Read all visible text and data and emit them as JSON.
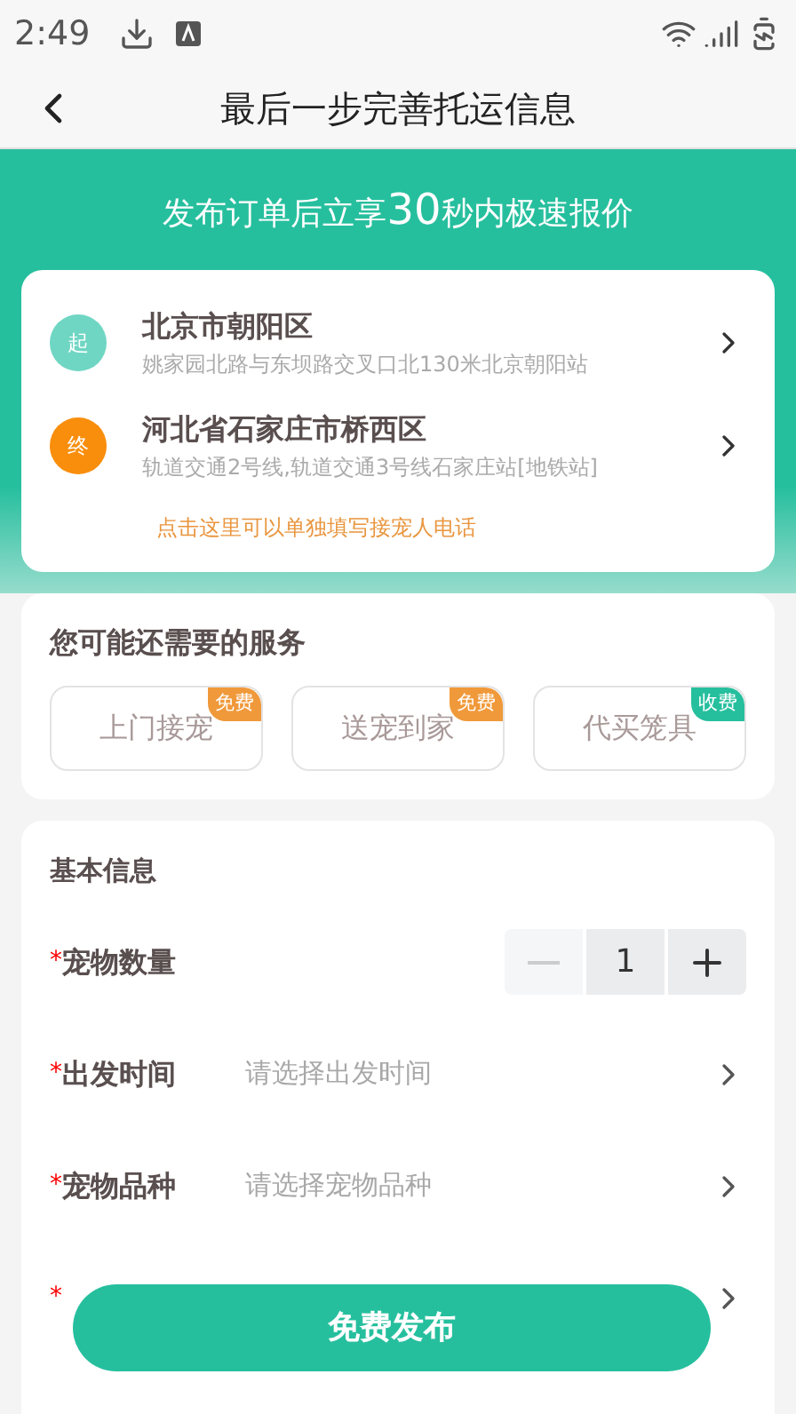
{
  "status_bar": {
    "time": "2:49"
  },
  "header": {
    "title": "最后一步完善托运信息"
  },
  "banner": {
    "before": "发布订单后立享",
    "highlight": "30",
    "after": "秒内极速报价"
  },
  "route": {
    "stops": [
      {
        "kind": "start",
        "badge": "起",
        "city": "北京市朝阳区",
        "address": "姚家园北路与东坝路交叉口北130米北京朝阳站"
      },
      {
        "kind": "end",
        "badge": "终",
        "city": "河北省石家庄市桥西区",
        "address": "轨道交通2号线,轨道交通3号线石家庄站[地铁站]"
      }
    ],
    "phone_link": "点击这里可以单独填写接宠人电话"
  },
  "services": {
    "title": "您可能还需要的服务",
    "items": [
      {
        "label": "上门接宠",
        "tag": "免费",
        "color": "#f0993a"
      },
      {
        "label": "送宠到家",
        "tag": "免费",
        "color": "#f0993a"
      },
      {
        "label": "代买笼具",
        "tag": "收费",
        "color": "#26bf9e"
      }
    ]
  },
  "basic_info": {
    "title": "基本信息",
    "rows": [
      {
        "kind": "stepper",
        "required_mark": "*",
        "label": "宠物数量",
        "value": "1",
        "decrement_disabled": true
      },
      {
        "kind": "select",
        "required_mark": "*",
        "label": "出发时间",
        "placeholder": "请选择出发时间"
      },
      {
        "kind": "select",
        "required_mark": "*",
        "label": "宠物品种",
        "placeholder": "请选择宠物品种"
      },
      {
        "kind": "select",
        "required_mark": "*"
      }
    ]
  },
  "submit_button": "免费发布"
}
